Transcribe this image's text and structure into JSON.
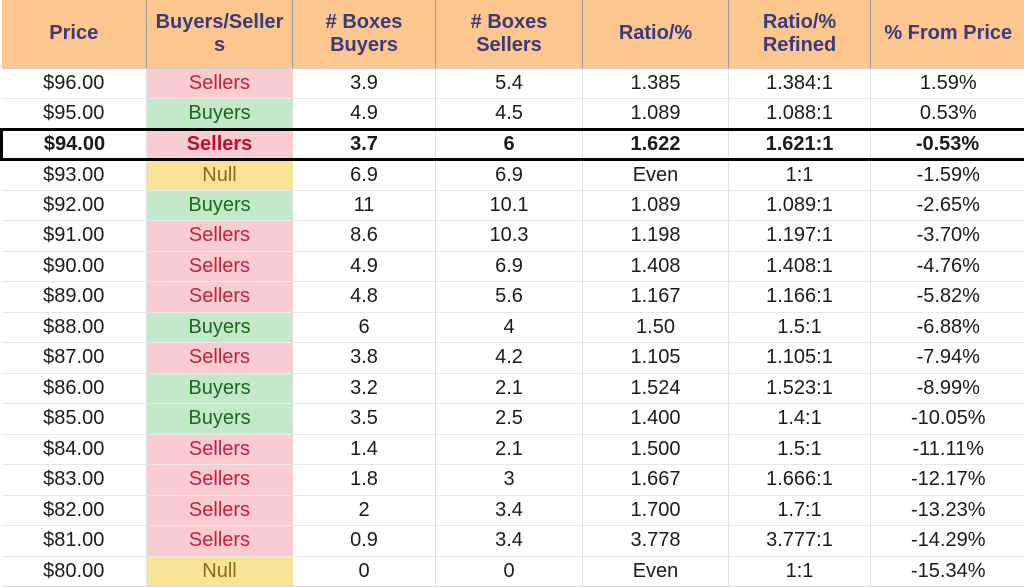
{
  "table": {
    "columns": [
      {
        "key": "price",
        "label": "Price"
      },
      {
        "key": "signal",
        "label": "Buyers/Sellers"
      },
      {
        "key": "boxes_buyers",
        "label": "# Boxes Buyers"
      },
      {
        "key": "boxes_sellers",
        "label": "# Boxes Sellers"
      },
      {
        "key": "ratio",
        "label": "Ratio/%"
      },
      {
        "key": "ratio_refined",
        "label": "Ratio/% Refined"
      },
      {
        "key": "pct_from_price",
        "label": "% From Price"
      }
    ],
    "colors": {
      "header_background": "#fbc78e",
      "header_text": "#3b3a7c",
      "sellers_background": "#f9ccd1",
      "sellers_text": "#c31f3c",
      "buyers_background": "#c4e8ca",
      "buyers_text": "#186b18",
      "null_background": "#f9e394",
      "null_text": "#8a6b1c",
      "highlight_border": "#000000"
    },
    "rows": [
      {
        "price": "$96.00",
        "signal": "Sellers",
        "signal_kind": "sellers",
        "boxes_buyers": "3.9",
        "boxes_sellers": "5.4",
        "ratio": "1.385",
        "ratio_refined": "1.384:1",
        "pct_from_price": "1.59%",
        "highlighted": false
      },
      {
        "price": "$95.00",
        "signal": "Buyers",
        "signal_kind": "buyers",
        "boxes_buyers": "4.9",
        "boxes_sellers": "4.5",
        "ratio": "1.089",
        "ratio_refined": "1.088:1",
        "pct_from_price": "0.53%",
        "highlighted": false
      },
      {
        "price": "$94.00",
        "signal": "Sellers",
        "signal_kind": "sellers",
        "boxes_buyers": "3.7",
        "boxes_sellers": "6",
        "ratio": "1.622",
        "ratio_refined": "1.621:1",
        "pct_from_price": "-0.53%",
        "highlighted": true
      },
      {
        "price": "$93.00",
        "signal": "Null",
        "signal_kind": "null",
        "boxes_buyers": "6.9",
        "boxes_sellers": "6.9",
        "ratio": "Even",
        "ratio_refined": "1:1",
        "pct_from_price": "-1.59%",
        "highlighted": false
      },
      {
        "price": "$92.00",
        "signal": "Buyers",
        "signal_kind": "buyers",
        "boxes_buyers": "11",
        "boxes_sellers": "10.1",
        "ratio": "1.089",
        "ratio_refined": "1.089:1",
        "pct_from_price": "-2.65%",
        "highlighted": false
      },
      {
        "price": "$91.00",
        "signal": "Sellers",
        "signal_kind": "sellers",
        "boxes_buyers": "8.6",
        "boxes_sellers": "10.3",
        "ratio": "1.198",
        "ratio_refined": "1.197:1",
        "pct_from_price": "-3.70%",
        "highlighted": false
      },
      {
        "price": "$90.00",
        "signal": "Sellers",
        "signal_kind": "sellers",
        "boxes_buyers": "4.9",
        "boxes_sellers": "6.9",
        "ratio": "1.408",
        "ratio_refined": "1.408:1",
        "pct_from_price": "-4.76%",
        "highlighted": false
      },
      {
        "price": "$89.00",
        "signal": "Sellers",
        "signal_kind": "sellers",
        "boxes_buyers": "4.8",
        "boxes_sellers": "5.6",
        "ratio": "1.167",
        "ratio_refined": "1.166:1",
        "pct_from_price": "-5.82%",
        "highlighted": false
      },
      {
        "price": "$88.00",
        "signal": "Buyers",
        "signal_kind": "buyers",
        "boxes_buyers": "6",
        "boxes_sellers": "4",
        "ratio": "1.50",
        "ratio_refined": "1.5:1",
        "pct_from_price": "-6.88%",
        "highlighted": false
      },
      {
        "price": "$87.00",
        "signal": "Sellers",
        "signal_kind": "sellers",
        "boxes_buyers": "3.8",
        "boxes_sellers": "4.2",
        "ratio": "1.105",
        "ratio_refined": "1.105:1",
        "pct_from_price": "-7.94%",
        "highlighted": false
      },
      {
        "price": "$86.00",
        "signal": "Buyers",
        "signal_kind": "buyers",
        "boxes_buyers": "3.2",
        "boxes_sellers": "2.1",
        "ratio": "1.524",
        "ratio_refined": "1.523:1",
        "pct_from_price": "-8.99%",
        "highlighted": false
      },
      {
        "price": "$85.00",
        "signal": "Buyers",
        "signal_kind": "buyers",
        "boxes_buyers": "3.5",
        "boxes_sellers": "2.5",
        "ratio": "1.400",
        "ratio_refined": "1.4:1",
        "pct_from_price": "-10.05%",
        "highlighted": false
      },
      {
        "price": "$84.00",
        "signal": "Sellers",
        "signal_kind": "sellers",
        "boxes_buyers": "1.4",
        "boxes_sellers": "2.1",
        "ratio": "1.500",
        "ratio_refined": "1.5:1",
        "pct_from_price": "-11.11%",
        "highlighted": false
      },
      {
        "price": "$83.00",
        "signal": "Sellers",
        "signal_kind": "sellers",
        "boxes_buyers": "1.8",
        "boxes_sellers": "3",
        "ratio": "1.667",
        "ratio_refined": "1.666:1",
        "pct_from_price": "-12.17%",
        "highlighted": false
      },
      {
        "price": "$82.00",
        "signal": "Sellers",
        "signal_kind": "sellers",
        "boxes_buyers": "2",
        "boxes_sellers": "3.4",
        "ratio": "1.700",
        "ratio_refined": "1.7:1",
        "pct_from_price": "-13.23%",
        "highlighted": false
      },
      {
        "price": "$81.00",
        "signal": "Sellers",
        "signal_kind": "sellers",
        "boxes_buyers": "0.9",
        "boxes_sellers": "3.4",
        "ratio": "3.778",
        "ratio_refined": "3.777:1",
        "pct_from_price": "-14.29%",
        "highlighted": false
      },
      {
        "price": "$80.00",
        "signal": "Null",
        "signal_kind": "null",
        "boxes_buyers": "0",
        "boxes_sellers": "0",
        "ratio": "Even",
        "ratio_refined": "1:1",
        "pct_from_price": "-15.34%",
        "highlighted": false
      }
    ]
  }
}
